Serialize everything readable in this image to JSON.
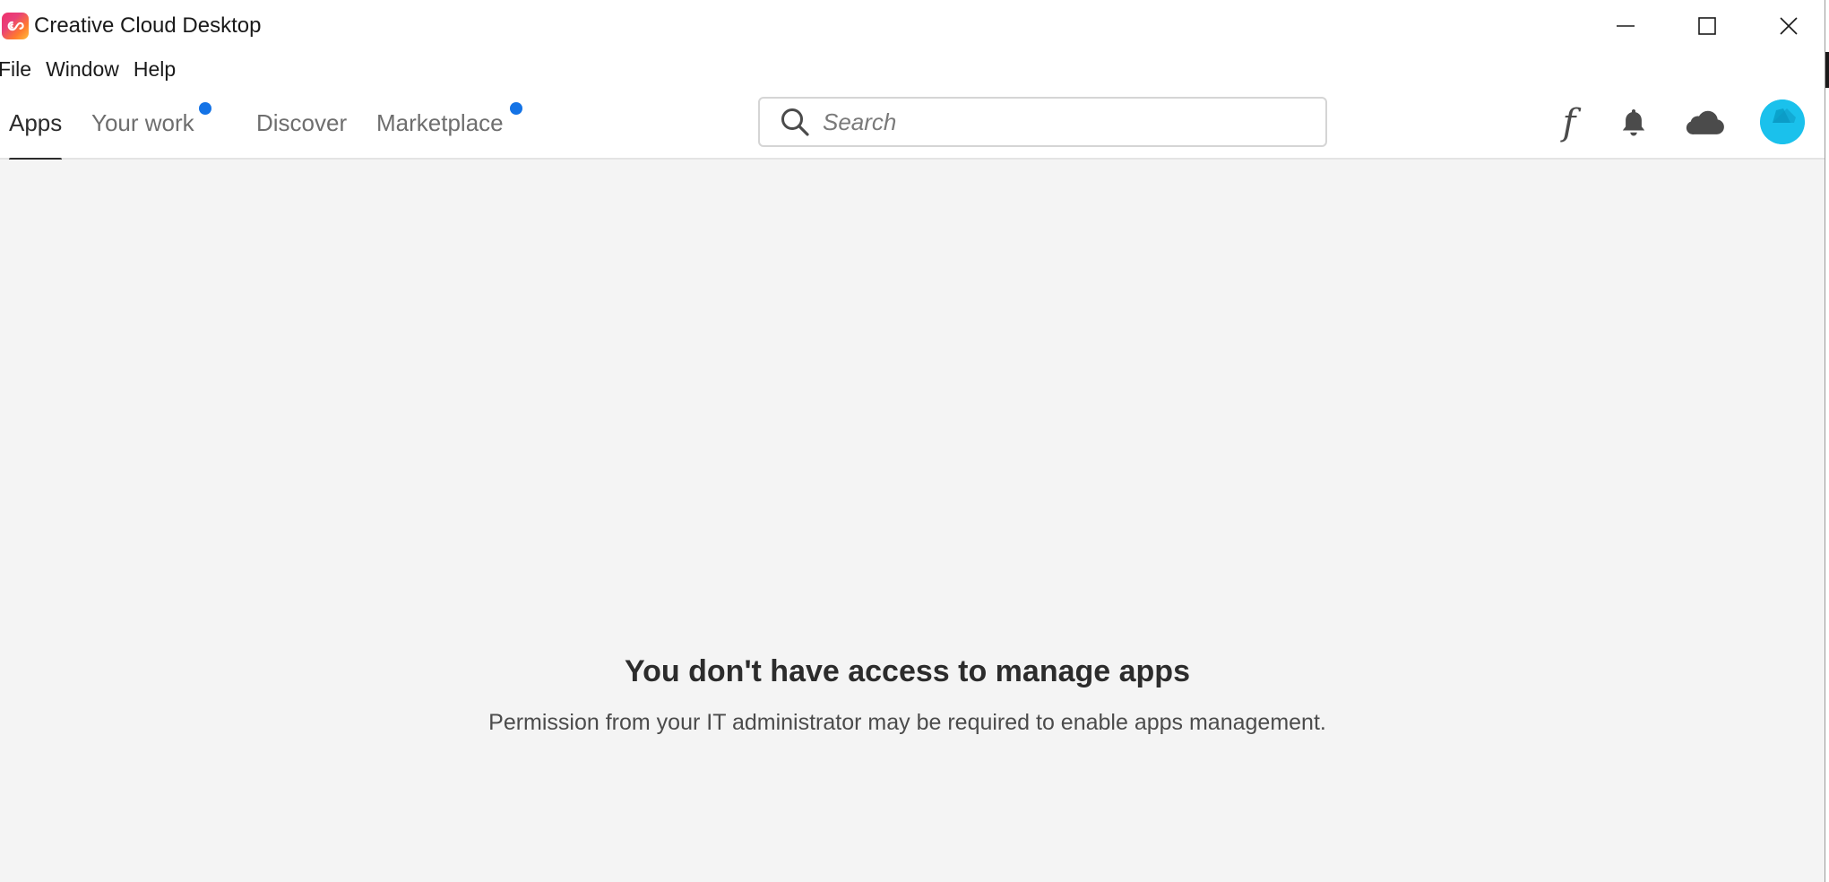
{
  "window": {
    "title": "Creative Cloud Desktop",
    "logo_icon": "creative-cloud-logo",
    "controls": {
      "minimize_icon": "minimize-icon",
      "maximize_icon": "maximize-icon",
      "close_icon": "close-icon"
    }
  },
  "menubar": {
    "items": [
      {
        "label": "File"
      },
      {
        "label": "Window"
      },
      {
        "label": "Help"
      }
    ]
  },
  "nav": {
    "tabs": [
      {
        "label": "Apps",
        "active": true,
        "has_notification_dot": false
      },
      {
        "label": "Your work",
        "active": false,
        "has_notification_dot": true
      },
      {
        "label": "Discover",
        "active": false,
        "has_notification_dot": false
      },
      {
        "label": "Marketplace",
        "active": false,
        "has_notification_dot": true
      }
    ],
    "search": {
      "placeholder": "Search",
      "value": ""
    },
    "right_icons": {
      "fonts_glyph": "f",
      "fonts_icon": "fonts-icon",
      "notifications_icon": "bell-icon",
      "cloud_icon": "cloud-icon",
      "avatar_icon": "avatar"
    }
  },
  "main": {
    "title": "You don't have access to manage apps",
    "description": "Permission from your IT administrator may be required to enable apps management."
  },
  "colors": {
    "accent_blue": "#1473e6",
    "avatar_cyan": "#1ac1ec",
    "content_background": "#f4f4f4",
    "text_primary": "#2c2c2c",
    "text_secondary": "#6e6e6e"
  }
}
